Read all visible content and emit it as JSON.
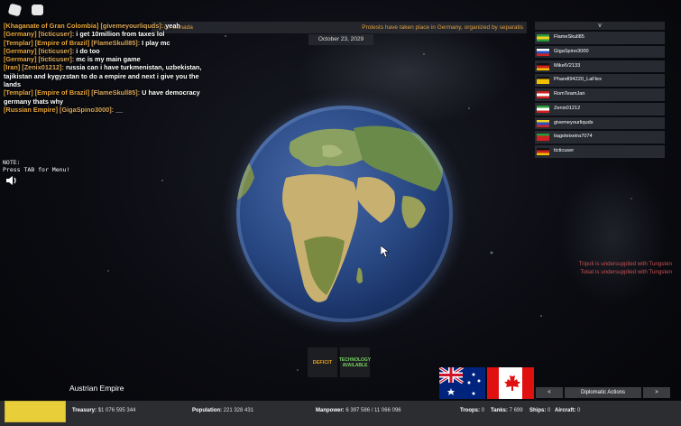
{
  "chat": [
    {
      "tags": [
        "[Khaganate of Gran Colombia]"
      ],
      "name": "[givemeyourliquds]:",
      "msg": "yeah"
    },
    {
      "tags": [
        "[Germany]"
      ],
      "name": "[ticticuser]:",
      "msg": "i get 10million from taxes lol"
    },
    {
      "tags": [
        "[Templar]",
        "[Empire of Brazil]"
      ],
      "name": "[FlameSkull85]:",
      "msg": "I play mc"
    },
    {
      "tags": [
        "[Germany]"
      ],
      "name": "[ticticuser]:",
      "msg": "i do too"
    },
    {
      "tags": [
        "[Germany]"
      ],
      "name": "[ticticuser]:",
      "msg": "mc is my main game"
    },
    {
      "tags": [
        "[Iran]"
      ],
      "name": "[Zenix01212]:",
      "msg": "russia can i have turkmenistan, uzbekistan, tajikistan and kygyzstan to do a empire and next i give you the lands"
    },
    {
      "tags": [
        "[Templar]",
        "[Empire of Brazil]"
      ],
      "name": "[FlameSkull85]:",
      "msg": "U have democracy germany thats why"
    },
    {
      "tags": [
        "[Russian Empire]"
      ],
      "name": "[GigaSpino3000]:",
      "msg": "__"
    }
  ],
  "news": {
    "left": "on Canada",
    "right": "Protests have taken place in Germany, organized by separatis"
  },
  "date": "October 23, 2029",
  "note": {
    "line1": "NOTE:",
    "line2": "Press TAB for Menu!"
  },
  "players": {
    "toggle": "v",
    "list": [
      {
        "name": "FlameSkull85",
        "flag": "brazil"
      },
      {
        "name": "GigaSpino3000",
        "flag": "russia"
      },
      {
        "name": "MikelV2133",
        "flag": "germany"
      },
      {
        "name": "Pharell94220_LaFlex",
        "flag": "germany-yellow"
      },
      {
        "name": "RomTeamJan",
        "flag": "austria"
      },
      {
        "name": "Zenix01212",
        "flag": "iran"
      },
      {
        "name": "givemeyourliquds",
        "flag": "colombia"
      },
      {
        "name": "tiagoteixeira7074",
        "flag": "portugal"
      },
      {
        "name": "ticticuser",
        "flag": "germany"
      }
    ]
  },
  "alerts": [
    "Tripoli is undersupplied with Tungsten",
    "Tokat is undersupplied with Tungsten"
  ],
  "buttons": {
    "deficit": "DEFICIT",
    "tech_line1": "TECHNOLOGY",
    "tech_line2": "AVAILABLE",
    "prev": "<",
    "diplomatic": "Diplomatic Actions",
    "next": ">"
  },
  "country": "Austrian Empire",
  "stats": {
    "treasury_label": "Treasury:",
    "treasury": "$1 076 595 344",
    "population_label": "Population:",
    "population": "221 328 431",
    "manpower_label": "Manpower:",
    "manpower": "6 397 586  /  11 066 096",
    "troops_label": "Troops:",
    "troops": "0",
    "tanks_label": "Tanks:",
    "tanks": "7 699",
    "ships_label": "Ships:",
    "ships": "0",
    "aircraft_label": "Aircraft:",
    "aircraft": "0"
  },
  "colors": {
    "chat_tag": "#e8a63a",
    "alert": "#c85050",
    "deficit": "#e8a020",
    "tech": "#7ad060",
    "player_flag_yellow": "#e8cf3a"
  },
  "icons": {
    "top_left": [
      "roblox-logo-icon",
      "chat-icon"
    ],
    "speaker": "speaker-icon"
  }
}
